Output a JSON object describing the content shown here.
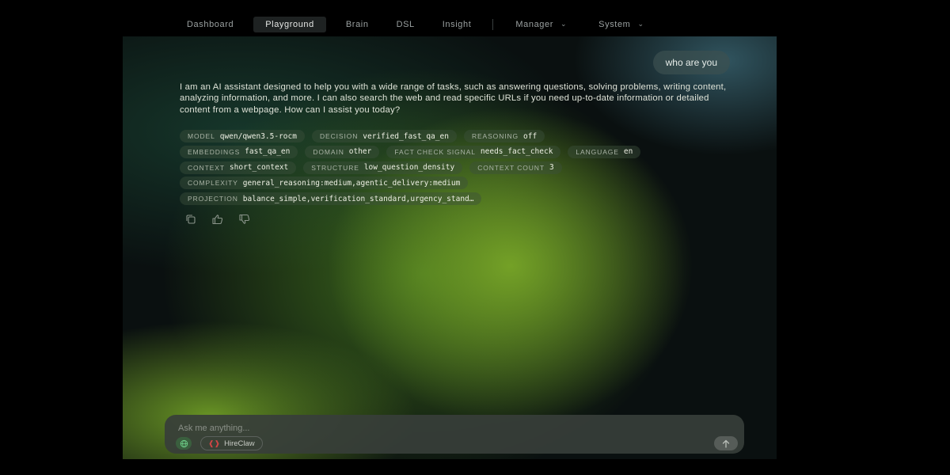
{
  "nav": {
    "items": [
      {
        "label": "Dashboard",
        "active": false
      },
      {
        "label": "Playground",
        "active": true
      },
      {
        "label": "Brain",
        "active": false
      },
      {
        "label": "DSL",
        "active": false
      },
      {
        "label": "Insight",
        "active": false
      }
    ],
    "dropdowns": [
      {
        "label": "Manager",
        "icon": "chevron-down-icon"
      },
      {
        "label": "System",
        "icon": "chevron-down-icon"
      }
    ]
  },
  "chat": {
    "user_message": "who are you",
    "assistant_message": "I am an AI assistant designed to help you with a wide range of tasks, such as answering questions, solving problems, writing content, analyzing information, and more. I can also search the web and read specific URLs if you need up-to-date information or detailed content from a webpage. How can I assist you today?",
    "tags": [
      [
        {
          "key": "MODEL",
          "value": "qwen/qwen3.5-rocm"
        },
        {
          "key": "DECISION",
          "value": "verified_fast_qa_en"
        },
        {
          "key": "REASONING",
          "value": "off"
        }
      ],
      [
        {
          "key": "EMBEDDINGS",
          "value": "fast_qa_en"
        },
        {
          "key": "DOMAIN",
          "value": "other"
        },
        {
          "key": "FACT CHECK SIGNAL",
          "value": "needs_fact_check"
        },
        {
          "key": "LANGUAGE",
          "value": "en"
        }
      ],
      [
        {
          "key": "CONTEXT",
          "value": "short_context"
        },
        {
          "key": "STRUCTURE",
          "value": "low_question_density"
        },
        {
          "key": "CONTEXT COUNT",
          "value": "3"
        }
      ],
      [
        {
          "key": "COMPLEXITY",
          "value": "general_reasoning:medium,agentic_delivery:medium"
        }
      ],
      [
        {
          "key": "PROJECTION",
          "value": "balance_simple,verification_standard,urgency_stand…"
        }
      ]
    ],
    "actions": [
      "copy-icon",
      "thumbs-up-icon",
      "thumbs-down-icon"
    ]
  },
  "composer": {
    "placeholder": "Ask me anything...",
    "value": "",
    "chip_label": "HireClaw",
    "chip_icon": "hireclaw-icon",
    "globe_icon": "globe-icon",
    "send_icon": "arrow-up-icon"
  },
  "colors": {
    "background": "#000000",
    "panel": "#0a1010",
    "accent_green": "#7aa828",
    "accent_teal": "#508ca0",
    "active_nav": "#1e2222"
  }
}
